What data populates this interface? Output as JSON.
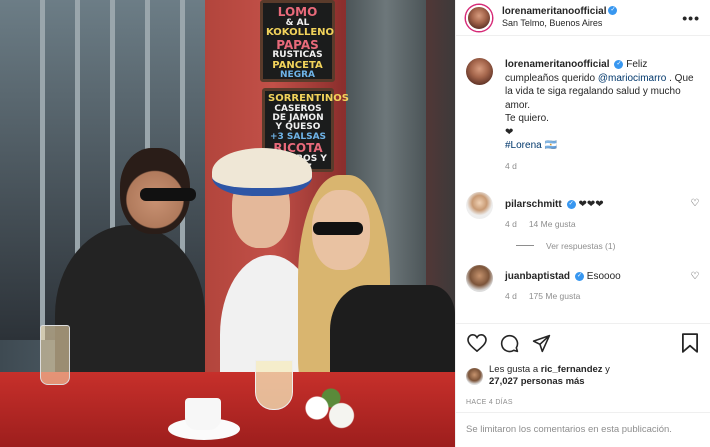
{
  "photo": {
    "board1": [
      "LOMO",
      "& AL",
      "KOKOLLENO",
      "PAPAS",
      "RUSTICAS",
      "PANCETA",
      "NEGRA"
    ],
    "board2": [
      "SORRENTINOS",
      "CASEROS DE JAMON",
      "Y QUESO",
      "+3 SALSAS",
      "RICOTA",
      "PUERROS Y NUEZ"
    ]
  },
  "header": {
    "username": "lorenameritanoofficial",
    "location": "San Telmo, Buenos Aires",
    "more_icon": "ellipsis-icon"
  },
  "caption": {
    "username": "lorenameritanoofficial",
    "text_before": "Feliz cumpleaños querido ",
    "mention": "@mariocimarro",
    "text_after": " . Que la vida te siga regalando salud y mucho amor.",
    "line2": "Te quiero.",
    "line3": "❤",
    "hashtag": "#Lorena",
    "hashtag_suffix": "🇦🇷",
    "time": "4 d"
  },
  "comments": [
    {
      "username": "pilarschmitt",
      "text": "❤❤❤",
      "time": "4 d",
      "likes": "14 Me gusta"
    },
    {
      "username": "juanbaptistad",
      "text": "Esoooo",
      "time": "4 d",
      "likes": "175 Me gusta"
    }
  ],
  "replies_label": "Ver respuestas (1)",
  "likes": {
    "prefix": "Les gusta a ",
    "user": "ric_fernandez",
    "middle": " y",
    "count": "27,027 personas más"
  },
  "time_ago": "HACE 4 DÍAS",
  "comments_limited": "Se limitaron los comentarios en esta publicación.",
  "colors": {
    "verified": "#3897f0",
    "link": "#00376b",
    "muted": "#8e8e8e"
  }
}
